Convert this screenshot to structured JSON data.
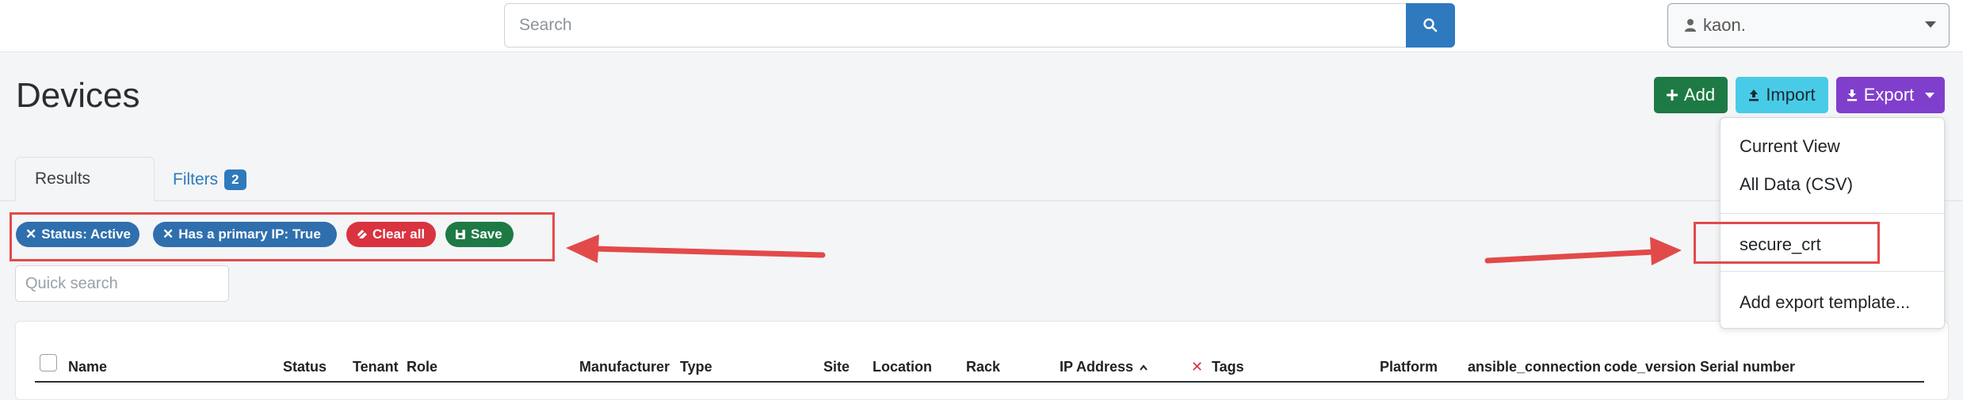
{
  "header": {
    "search_placeholder": "Search",
    "user_label": "kaon."
  },
  "page": {
    "title": "Devices",
    "add_label": "Add",
    "import_label": "Import",
    "export_label": "Export"
  },
  "tabs": {
    "results_label": "Results",
    "filters_label": "Filters",
    "filters_count": "2"
  },
  "filters": {
    "status_label": "Status: Active",
    "ip_label": "Has a primary IP: True",
    "clear_label": "Clear all",
    "save_label": "Save"
  },
  "quick_search_placeholder": "Quick search",
  "table": {
    "columns": [
      "Name",
      "Status",
      "Tenant",
      "Role",
      "Manufacturer",
      "Type",
      "Site",
      "Location",
      "Rack",
      "IP Address",
      "Tags",
      "Platform",
      "ansible_connection",
      "code_version",
      "Serial number"
    ]
  },
  "export_menu": {
    "current_view": "Current View",
    "all_data": "All Data (CSV)",
    "secure_crt": "secure_crt",
    "add_template": "Add export template..."
  },
  "colors": {
    "primary": "#2f79be",
    "add": "#1e7a45",
    "import": "#48cbe6",
    "export": "#7f3fcc",
    "danger": "#d93340",
    "annotation": "#e24a4a"
  }
}
